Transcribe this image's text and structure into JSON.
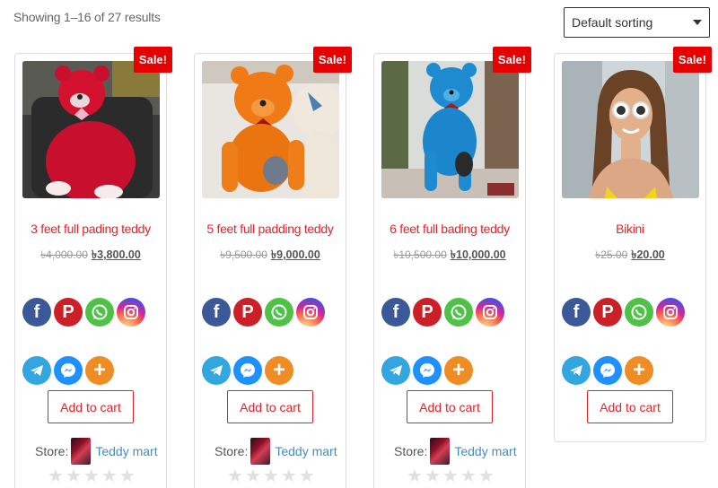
{
  "result_count": "Showing 1–16 of 27 results",
  "sorting": {
    "selected": "Default sorting"
  },
  "sale_label": "Sale!",
  "add_to_cart_label": "Add to cart",
  "store_label": "Store:",
  "products": [
    {
      "title": "3 feet full pading teddy",
      "old_price": "৳4,000.00",
      "new_price": "৳3,800.00",
      "store": "Teddy mart",
      "rating": 0
    },
    {
      "title": "5 feet full padding teddy",
      "old_price": "৳9,500.00",
      "new_price": "৳9,000.00",
      "store": "Teddy mart",
      "rating": 0
    },
    {
      "title": "6 feet full bading teddy",
      "old_price": "৳10,500.00",
      "new_price": "৳10,000.00",
      "store": "Teddy mart",
      "rating": 0
    },
    {
      "title": "Bikini",
      "old_price": "৳25.00",
      "new_price": "৳20.00",
      "store": "",
      "rating": null
    }
  ],
  "share_icons_row1": [
    "facebook-icon",
    "pinterest-icon",
    "whatsapp-icon",
    "instagram-icon"
  ],
  "share_icons_row2": [
    "telegram-icon",
    "messenger-icon",
    "more-share-icon"
  ],
  "colors": {
    "accent_red": "#e2232a",
    "sale_badge": "#e60000",
    "store_link": "#3b8fc4",
    "facebook": "#3b5998",
    "pinterest": "#cb2027",
    "whatsapp": "#4dc247",
    "telegram": "#32a6e0",
    "messenger": "#1e90ff",
    "share_more": "#f08c24"
  }
}
